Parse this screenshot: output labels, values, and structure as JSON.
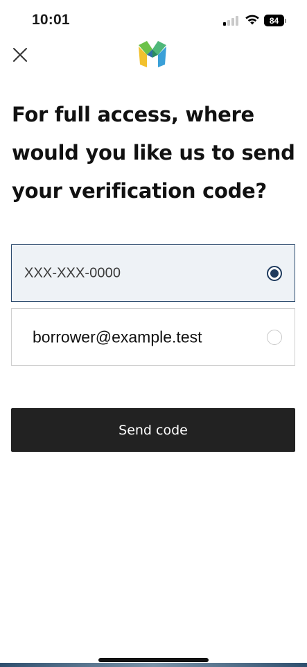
{
  "status_bar": {
    "time": "10:01",
    "battery": "84"
  },
  "header": {
    "close_icon": "close-icon",
    "logo_icon": "app-logo-icon",
    "logo_colors": [
      "#f2c12e",
      "#6cc24a",
      "#3aa0d8",
      "#2f6fa8"
    ]
  },
  "title": "For full access, where would you like us to send your verification code?",
  "options": [
    {
      "label": "XXX-XXX-0000",
      "selected": true
    },
    {
      "label": "borrower@example.test",
      "selected": false
    }
  ],
  "send_button": {
    "label": "Send code"
  },
  "colors": {
    "selected_border": "#2d4b6e",
    "selected_background": "#eef2f6",
    "radio_checked": "#1f3b5e",
    "button_background": "#222222"
  }
}
